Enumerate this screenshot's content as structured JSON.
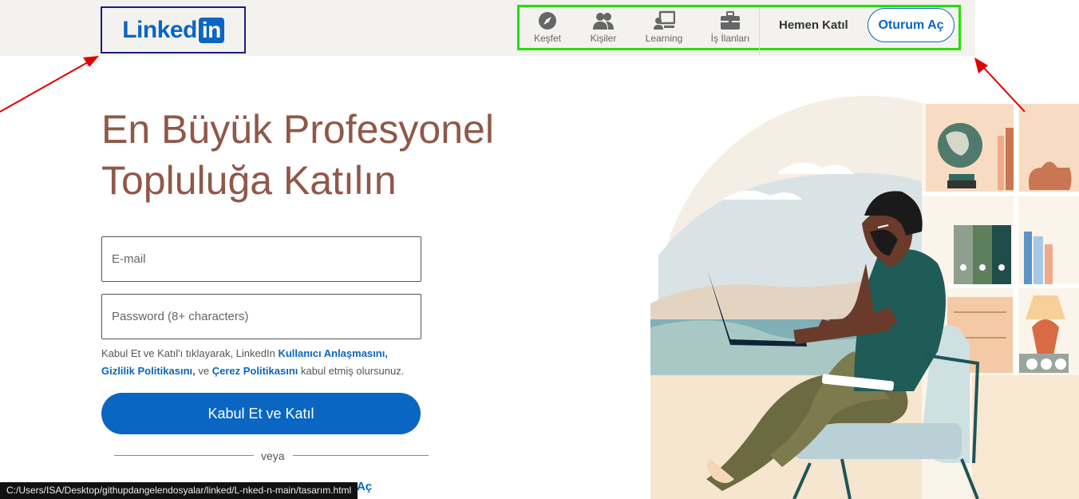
{
  "header": {
    "logo_text": "Linked",
    "logo_in": "in",
    "nav": [
      {
        "label": "Keşfet",
        "icon": "compass-icon"
      },
      {
        "label": "Kişiler",
        "icon": "people-icon"
      },
      {
        "label": "Learning",
        "icon": "learning-icon"
      },
      {
        "label": "İş İlanları",
        "icon": "briefcase-icon"
      }
    ],
    "join_label": "Hemen Katıl",
    "signin_label": "Oturum Aç"
  },
  "main": {
    "headline_line1": "En Büyük Profesyonel",
    "headline_line2": "Topluluğa Katılın",
    "email_placeholder": "E-mail",
    "password_placeholder": "Password (8+ characters)",
    "terms_prefix": "Kabul Et ve Katıl'ı tıklayarak, LinkedIn ",
    "terms_user_agreement": "Kullanıcı Anlaşmasını,",
    "terms_privacy": "Gizlilik Politikasını,",
    "terms_mid": " ve ",
    "terms_cookie": "Çerez Politikasını",
    "terms_suffix": " kabul etmiş olursunuz.",
    "submit_label": "Kabul Et ve Katıl",
    "or_label": "veya",
    "bottom_signin_label": "m Aç"
  },
  "status_bar": {
    "url": "C:/Users/ISA/Desktop/githupdangelendosyalar/linked/L-nked-n-main/tasarım.html"
  },
  "colors": {
    "brand": "#0a66c2",
    "headline": "#8f5849",
    "logo_annotation": "#1a1f7a",
    "nav_annotation": "#22e000",
    "arrow": "#e00000"
  }
}
